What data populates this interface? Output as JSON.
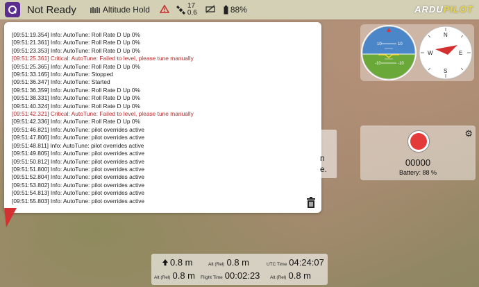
{
  "toolbar": {
    "status": "Not Ready",
    "flight_mode": "Altitude Hold",
    "gps_count": "17",
    "gps_hdop": "0.6",
    "battery": "88%",
    "brand_ardu": "ARDU",
    "brand_pilot": "PILOT"
  },
  "log": [
    {
      "text": "[09:51:19.354] Info: AutoTune: Roll Rate D Up 0%",
      "level": "info"
    },
    {
      "text": "[09:51:21.361] Info: AutoTune: Roll Rate D Up 0%",
      "level": "info"
    },
    {
      "text": "[09:51:23.353] Info: AutoTune: Roll Rate D Up 0%",
      "level": "info"
    },
    {
      "text": "[09:51:25.361] Critical: AutoTune: Failed to level, please tune manually",
      "level": "critical"
    },
    {
      "text": "[09:51:25.365] Info: AutoTune: Roll Rate D Up 0%",
      "level": "info"
    },
    {
      "text": "[09:51:33.165] Info: AutoTune: Stopped",
      "level": "info"
    },
    {
      "text": "[09:51:36.347] Info: AutoTune: Started",
      "level": "info"
    },
    {
      "text": "[09:51:36.359] Info: AutoTune: Roll Rate D Up 0%",
      "level": "info"
    },
    {
      "text": "[09:51:38.331] Info: AutoTune: Roll Rate D Up 0%",
      "level": "info"
    },
    {
      "text": "[09:51:40.324] Info: AutoTune: Roll Rate D Up 0%",
      "level": "info"
    },
    {
      "text": "[09:51:42.321] Critical: AutoTune: Failed to level, please tune manually",
      "level": "critical"
    },
    {
      "text": "[09:51:42.336] Info: AutoTune: Roll Rate D Up 0%",
      "level": "info"
    },
    {
      "text": "[09:51:46.821] Info: AutoTune: pilot overrides active",
      "level": "info"
    },
    {
      "text": "[09:51:47.806] Info: AutoTune: pilot overrides active",
      "level": "info"
    },
    {
      "text": "[09:51:48.811] Info: AutoTune: pilot overrides active",
      "level": "info"
    },
    {
      "text": "[09:51:49.805] Info: AutoTune: pilot overrides active",
      "level": "info"
    },
    {
      "text": "[09:51:50.812] Info: AutoTune: pilot overrides active",
      "level": "info"
    },
    {
      "text": "[09:51:51.800] Info: AutoTune: pilot overrides active",
      "level": "info"
    },
    {
      "text": "[09:51:52.804] Info: AutoTune: pilot overrides active",
      "level": "info"
    },
    {
      "text": "[09:51:53.802] Info: AutoTune: pilot overrides active",
      "level": "info"
    },
    {
      "text": "[09:51:54.813] Info: AutoTune: pilot overrides active",
      "level": "info"
    },
    {
      "text": "[09:51:55.803] Info: AutoTune: pilot overrides active",
      "level": "info"
    }
  ],
  "side_widget": {
    "line1": "n",
    "line2": "e."
  },
  "attitude": {
    "pitch_up": "10",
    "pitch_down": "-10",
    "pitch_up_right": "10",
    "pitch_down_right": "-10"
  },
  "compass": {
    "north": "N",
    "east": "E",
    "south": "S",
    "west": "W"
  },
  "camera": {
    "count": "00000",
    "battery": "Battery: 88 %"
  },
  "values": {
    "vspeed_value": "0.8 m",
    "alt_rel_label": "Alt (Rel)",
    "alt_rel_value": "0.8 m",
    "utc_label": "UTC Time",
    "utc_value": "04:24:07",
    "alt_rel2_label": "Alt (Rel)",
    "alt_rel2_value": "0.8 m",
    "flight_time_label": "Flight Time",
    "flight_time_value": "00:02:23",
    "alt_rel3_label": "Alt (Rel)",
    "alt_rel3_value": "0.8 m"
  },
  "colors": {
    "toolbar_bg": "#d3d0b5",
    "critical": "#b82a2a",
    "record": "#e33a3a",
    "sky": "#4a86c8",
    "ground": "#6aa83a"
  }
}
